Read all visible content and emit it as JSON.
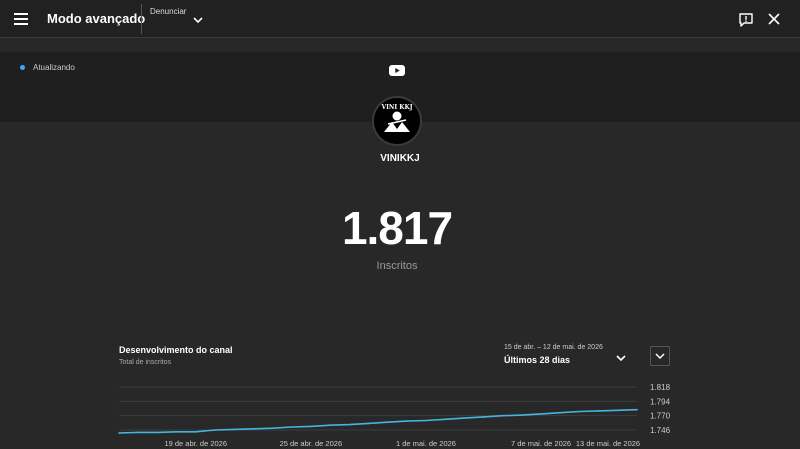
{
  "topbar": {
    "title": "Modo avançado",
    "report_label": "Denunciar"
  },
  "status": {
    "text": "Atualizando"
  },
  "channel": {
    "name": "VINIKKJ",
    "avatar_text": "VINI KKJ"
  },
  "subscribers": {
    "count": "1.817",
    "label": "Inscritos"
  },
  "chart_section": {
    "title": "Desenvolvimento do canal",
    "subtitle": "Total de inscritos",
    "date_range": "15 de abr. – 12 de mai. de 2026",
    "period": "Últimos 28 dias"
  },
  "colors": {
    "accent": "#3ea6ff",
    "line": "#47b4e0",
    "background": "#282828"
  },
  "chart_data": {
    "type": "line",
    "x": [
      "2026-04-15",
      "2026-04-16",
      "2026-04-17",
      "2026-04-18",
      "2026-04-19",
      "2026-04-20",
      "2026-04-21",
      "2026-04-22",
      "2026-04-23",
      "2026-04-24",
      "2026-04-25",
      "2026-04-26",
      "2026-04-27",
      "2026-04-28",
      "2026-04-29",
      "2026-04-30",
      "2026-05-01",
      "2026-05-02",
      "2026-05-03",
      "2026-05-04",
      "2026-05-05",
      "2026-05-06",
      "2026-05-07",
      "2026-05-08",
      "2026-05-09",
      "2026-05-10",
      "2026-05-11",
      "2026-05-12"
    ],
    "series": [
      {
        "values": [
          1741,
          1742,
          1742,
          1743,
          1743,
          1746,
          1747,
          1748,
          1749,
          1751,
          1752,
          1754,
          1755,
          1757,
          1759,
          1761,
          1762,
          1764,
          1766,
          1768,
          1770,
          1771,
          1773,
          1775,
          1777,
          1778,
          1779,
          1780
        ]
      }
    ],
    "x_ticks": [
      {
        "date": "2026-04-19",
        "label": "19 de abr. de 2026"
      },
      {
        "date": "2026-04-25",
        "label": "25 de abr. de 2026"
      },
      {
        "date": "2026-05-01",
        "label": "1 de mai. de 2026"
      },
      {
        "date": "2026-05-07",
        "label": "7 de mai. de 2026"
      },
      {
        "date": "2026-05-13",
        "label": "13 de mai. de 2026"
      }
    ],
    "y_ticks": [
      1818,
      1794,
      1770,
      1746
    ],
    "y_tick_labels": [
      "1.818",
      "1.794",
      "1.770",
      "1.746"
    ],
    "grid": true
  }
}
